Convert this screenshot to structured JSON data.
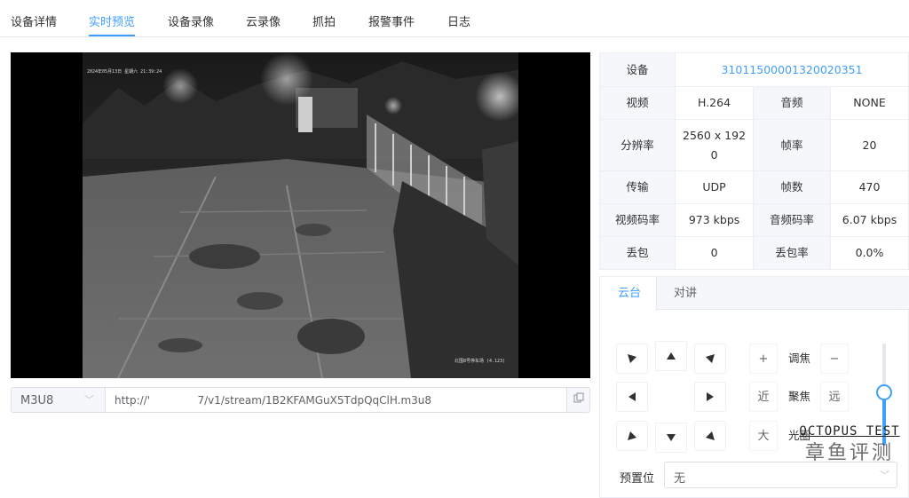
{
  "tabs": [
    {
      "label": "设备详情",
      "active": false
    },
    {
      "label": "实时预览",
      "active": true
    },
    {
      "label": "设备录像",
      "active": false
    },
    {
      "label": "云录像",
      "active": false
    },
    {
      "label": "抓拍",
      "active": false
    },
    {
      "label": "报警事件",
      "active": false
    },
    {
      "label": "日志",
      "active": false
    }
  ],
  "video": {
    "osd_top": "2024年05月13日 星期六 21:39:24",
    "osd_bottom": "北围8号停车场 (4.123)"
  },
  "stream": {
    "protocol": "M3U8",
    "url": "http://'              7/v1/stream/1B2KFAMGuX5TdpQqClH.m3u8",
    "copy_icon": "copy-icon"
  },
  "info": {
    "device_label": "设备",
    "device_value": "31011500001320020351",
    "video_label": "视频",
    "video_value": "H.264",
    "audio_label": "音频",
    "audio_value": "NONE",
    "resolution_label": "分辨率",
    "resolution_line1": "2560 x 192",
    "resolution_line2": "0",
    "fps_label": "帧率",
    "fps_value": "20",
    "transport_label": "传输",
    "transport_value": "UDP",
    "frames_label": "帧数",
    "frames_value": "470",
    "vbitrate_label": "视频码率",
    "vbitrate_value": "973 kbps",
    "abitrate_label": "音频码率",
    "abitrate_value": "6.07 kbps",
    "loss_label": "丢包",
    "loss_value": "0",
    "loss_rate_label": "丢包率",
    "loss_rate_value": "0.0%"
  },
  "control": {
    "tabs": [
      {
        "label": "云台",
        "active": true
      },
      {
        "label": "对讲",
        "active": false
      }
    ],
    "zoom_in": "+",
    "zoom_label": "调焦",
    "zoom_out": "−",
    "focus_near": "近",
    "focus_label": "聚焦",
    "focus_far": "远",
    "iris_open": "大",
    "iris_label": "光圈",
    "speed_level": 0.52,
    "preset_label": "预置位",
    "preset_value": "无"
  },
  "watermark": {
    "en": "OCTOPUS TEST",
    "cn": "章鱼评测"
  },
  "colors": {
    "accent": "#409eff",
    "border": "#ebeef5",
    "header_bg": "#f5f7fa"
  }
}
